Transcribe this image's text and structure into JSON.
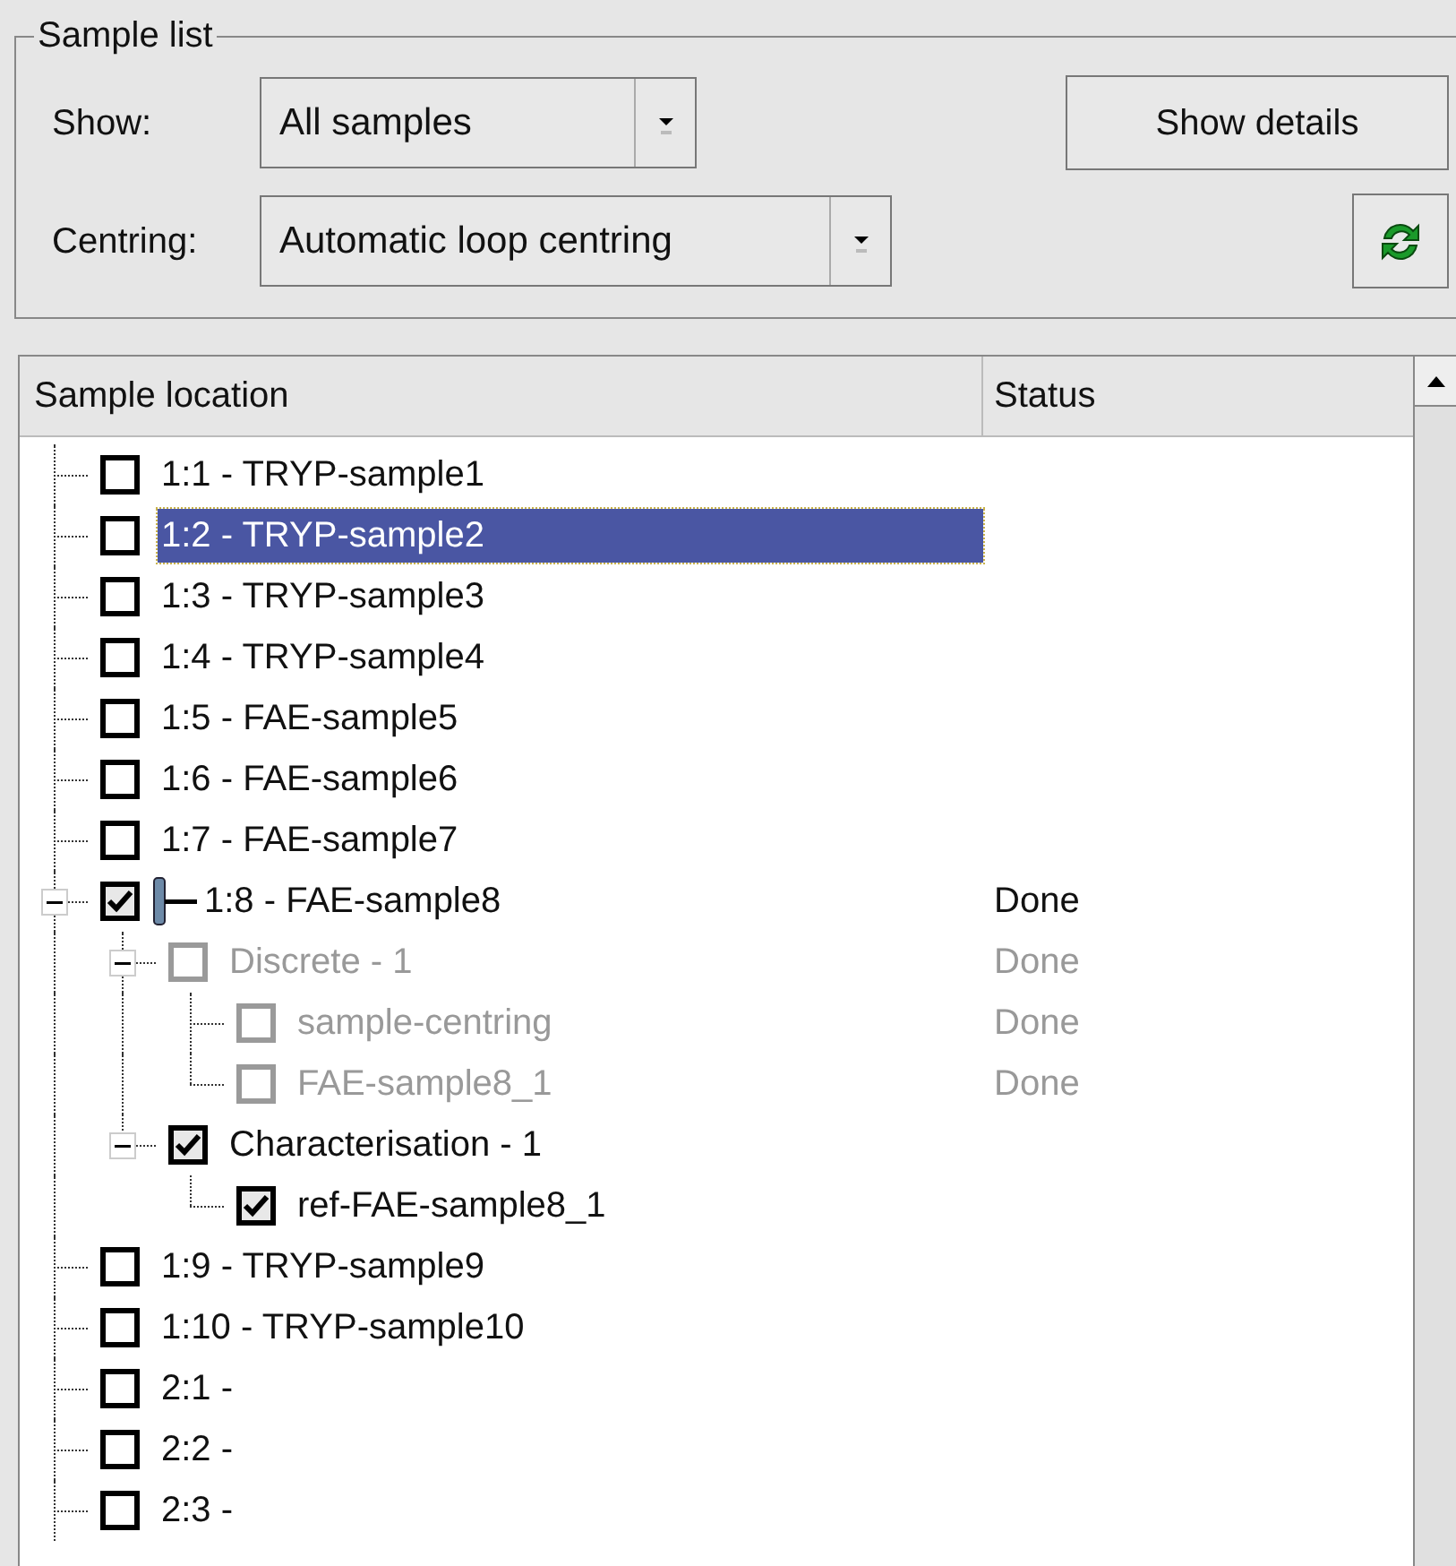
{
  "sample_list": {
    "title": "Sample list",
    "show": {
      "label": "Show:",
      "value": "All samples"
    },
    "centring": {
      "label": "Centring:",
      "value": "Automatic loop centring"
    },
    "show_details_button": "Show details"
  },
  "tree": {
    "columns": [
      "Sample location",
      "Status"
    ],
    "items": [
      {
        "label": "1:1 - TRYP-sample1",
        "checked": false,
        "selected": false,
        "disabled": false,
        "mounted": false
      },
      {
        "label": "1:2 - TRYP-sample2",
        "checked": false,
        "selected": true,
        "disabled": false,
        "mounted": false
      },
      {
        "label": "1:3 - TRYP-sample3",
        "checked": false,
        "selected": false,
        "disabled": false,
        "mounted": false
      },
      {
        "label": "1:4 - TRYP-sample4",
        "checked": false,
        "selected": false,
        "disabled": false,
        "mounted": false
      },
      {
        "label": "1:5 - FAE-sample5",
        "checked": false,
        "selected": false,
        "disabled": false,
        "mounted": false
      },
      {
        "label": "1:6 - FAE-sample6",
        "checked": false,
        "selected": false,
        "disabled": false,
        "mounted": false
      },
      {
        "label": "1:7 - FAE-sample7",
        "checked": false,
        "selected": false,
        "disabled": false,
        "mounted": false
      },
      {
        "label": "1:8 - FAE-sample8",
        "checked": true,
        "selected": false,
        "disabled": false,
        "mounted": true,
        "status": "Done",
        "expanded": true,
        "children": [
          {
            "label": "Discrete - 1",
            "checked": false,
            "selected": false,
            "disabled": true,
            "status": "Done",
            "expanded": true,
            "children": [
              {
                "label": "sample-centring",
                "checked": false,
                "selected": false,
                "disabled": true,
                "status": "Done"
              },
              {
                "label": "FAE-sample8_1",
                "checked": false,
                "selected": false,
                "disabled": true,
                "status": "Done"
              }
            ]
          },
          {
            "label": "Characterisation - 1",
            "checked": true,
            "selected": false,
            "disabled": false,
            "expanded": true,
            "children": [
              {
                "label": "ref-FAE-sample8_1",
                "checked": true,
                "selected": false,
                "disabled": false
              }
            ]
          }
        ]
      },
      {
        "label": "1:9 - TRYP-sample9",
        "checked": false,
        "selected": false,
        "disabled": false,
        "mounted": false
      },
      {
        "label": "1:10 - TRYP-sample10",
        "checked": false,
        "selected": false,
        "disabled": false,
        "mounted": false
      },
      {
        "label": "2:1 -",
        "checked": false,
        "selected": false,
        "disabled": false,
        "mounted": false
      },
      {
        "label": "2:2 -",
        "checked": false,
        "selected": false,
        "disabled": false,
        "mounted": false
      },
      {
        "label": "2:3 -",
        "checked": false,
        "selected": false,
        "disabled": false,
        "mounted": false
      }
    ]
  }
}
